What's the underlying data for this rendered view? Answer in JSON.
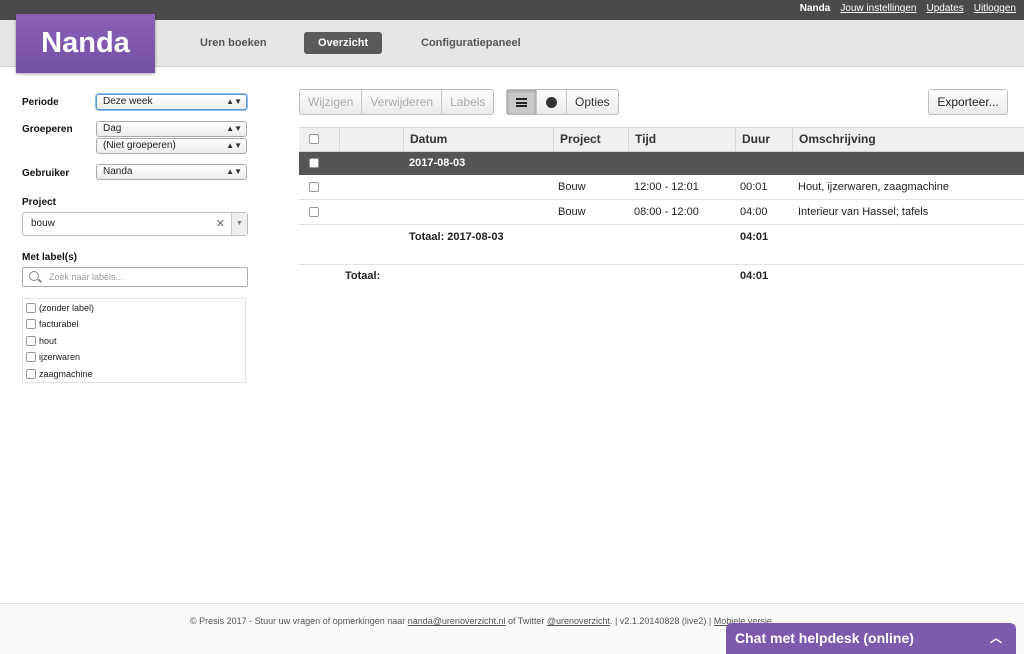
{
  "topbar": {
    "user": "Nanda",
    "links": [
      "Jouw instellingen",
      "Updates",
      "Uitloggen"
    ]
  },
  "logo": "Nanda",
  "nav": [
    "Uren boeken",
    "Overzicht",
    "Configuratiepaneel"
  ],
  "filters": {
    "periode_label": "Periode",
    "periode_value": "Deze week",
    "groeperen_label": "Groeperen",
    "groeperen_value1": "Dag",
    "groeperen_value2": "(Niet groeperen)",
    "gebruiker_label": "Gebruiker",
    "gebruiker_value": "Nanda",
    "project_label": "Project",
    "project_value": "bouw",
    "labels_label": "Met label(s)",
    "labels_search_placeholder": "Zoek naar labels...",
    "labels": [
      "(zonder label)",
      "facturabel",
      "hout",
      "ijzerwaren",
      "zaagmachine"
    ]
  },
  "toolbar": {
    "wijzigen": "Wijzigen",
    "verwijderen": "Verwijderen",
    "labels": "Labels",
    "opties": "Opties",
    "exporteer": "Exporteer..."
  },
  "table": {
    "columns": [
      "Datum",
      "Project",
      "Tijd",
      "Duur",
      "Omschrijving"
    ],
    "group_date": "2017-08-03",
    "rows": [
      {
        "project": "Bouw",
        "tijd": "12:00 - 12:01",
        "duur": "00:01",
        "omschrijving": "Hout, ijzerwaren, zaagmachine"
      },
      {
        "project": "Bouw",
        "tijd": "08:00 - 12:00",
        "duur": "04:00",
        "omschrijving": "Interieur van Hassel; tafels"
      }
    ],
    "subtotal_label": "Totaal: 2017-08-03",
    "subtotal_value": "04:01",
    "total_label": "Totaal:",
    "total_value": "04:01"
  },
  "footer": {
    "text1": "© Presis 2017 - Stuur uw vragen of opmerkingen naar",
    "email": "nanda@urenoverzicht.nl",
    "text2": "of Twitter",
    "twitter": "@urenoverzicht",
    "text3": ".   |  v2.1.20140828 (live2)  |",
    "mobile": "Mobiele versie"
  },
  "chat": "Chat met helpdesk (online)"
}
